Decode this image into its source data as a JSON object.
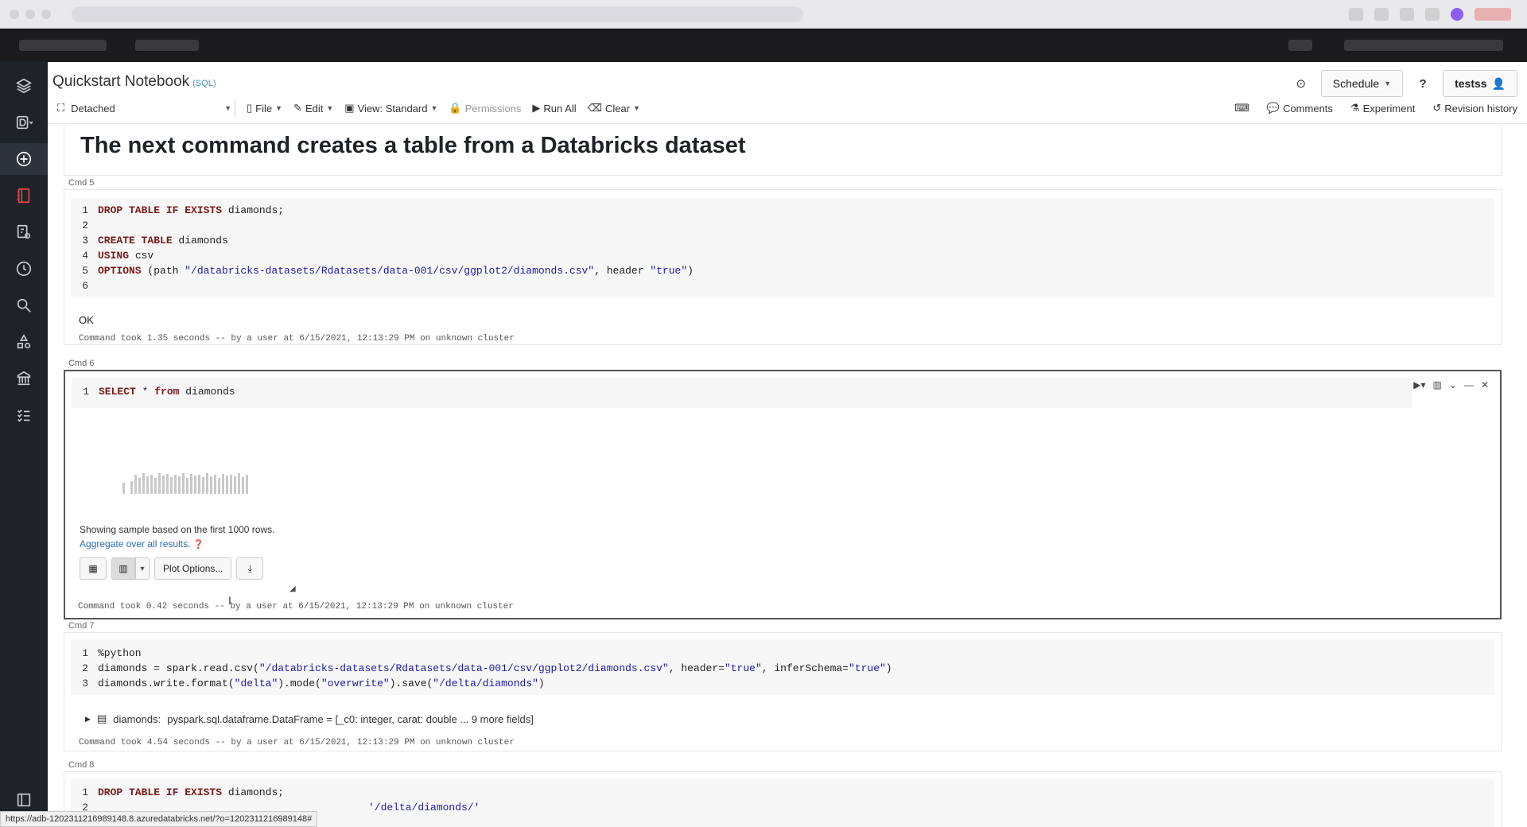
{
  "header": {
    "title": "Quickstart Notebook",
    "language_badge": "(SQL)",
    "schedule_label": "Schedule",
    "help_label": "?",
    "user_label": "testss"
  },
  "toolbar": {
    "cluster_label": "Detached",
    "file_label": "File",
    "edit_label": "Edit",
    "view_label": "View: Standard",
    "permissions_label": "Permissions",
    "run_all_label": "Run All",
    "clear_label": "Clear",
    "comments_label": "Comments",
    "experiment_label": "Experiment",
    "revision_label": "Revision history"
  },
  "cells": {
    "heading_cell": {
      "heading": "The next command creates a table from a Databricks dataset"
    },
    "cmd5": {
      "label": "Cmd 5",
      "lines": [
        {
          "n": "1",
          "kw": "DROP TABLE IF EXISTS",
          "rest": " diamonds;"
        },
        {
          "n": "2",
          "kw": "",
          "rest": ""
        },
        {
          "n": "3",
          "kw": "CREATE TABLE",
          "rest": " diamonds"
        },
        {
          "n": "4",
          "kw": "USING",
          "rest": " csv"
        },
        {
          "n": "5",
          "kw": "OPTIONS",
          "rest": " (path ",
          "str1": "\"/databricks-datasets/Rdatasets/data-001/csv/ggplot2/diamonds.csv\"",
          "rest2": ", header ",
          "str2": "\"true\"",
          "rest3": ")"
        },
        {
          "n": "6",
          "kw": "",
          "rest": ""
        }
      ],
      "output": "OK",
      "meta": "Command took 1.35 seconds -- by a user at 6/15/2021, 12:13:29 PM on unknown cluster"
    },
    "cmd6": {
      "label": "Cmd 6",
      "line_no": "1",
      "kw1": "SELECT",
      "mid": " * ",
      "kw2": "from",
      "rest": " diamonds",
      "sample_text": "Showing sample based on the first 1000 rows.",
      "aggregate_link": "Aggregate over all results.",
      "plot_options_label": "Plot Options...",
      "meta": "Command took 0.42 seconds -- by a user at 6/15/2021, 12:13:29 PM on unknown cluster"
    },
    "cmd7": {
      "label": "Cmd 7",
      "line1_no": "1",
      "line1": "%python",
      "line2_no": "2",
      "line2_a": "diamonds = spark.read.csv(",
      "line2_s1": "\"/databricks-datasets/Rdatasets/data-001/csv/ggplot2/diamonds.csv\"",
      "line2_b": ", header=",
      "line2_s2": "\"true\"",
      "line2_c": ", inferSchema=",
      "line2_s3": "\"true\"",
      "line2_d": ")",
      "line3_no": "3",
      "line3_a": "diamonds.write.format(",
      "line3_s1": "\"delta\"",
      "line3_b": ").mode(",
      "line3_s2": "\"overwrite\"",
      "line3_c": ").save(",
      "line3_s3": "\"/delta/diamonds\"",
      "line3_d": ")",
      "df_name": "diamonds:",
      "df_type": "pyspark.sql.dataframe.DataFrame = [_c0: integer, carat: double ... 9 more fields]",
      "meta": "Command took 4.54 seconds -- by a user at 6/15/2021, 12:13:29 PM on unknown cluster"
    },
    "cmd8": {
      "label": "Cmd 8",
      "line1_no": "1",
      "kw": "DROP TABLE IF EXISTS",
      "rest": " diamonds;",
      "line2_no": "2",
      "partial": "'/delta/diamonds/'"
    }
  },
  "status_bar": {
    "url": "https://adb-1202311216989148.8.azuredatabricks.net/?o=1202311216989148#"
  }
}
